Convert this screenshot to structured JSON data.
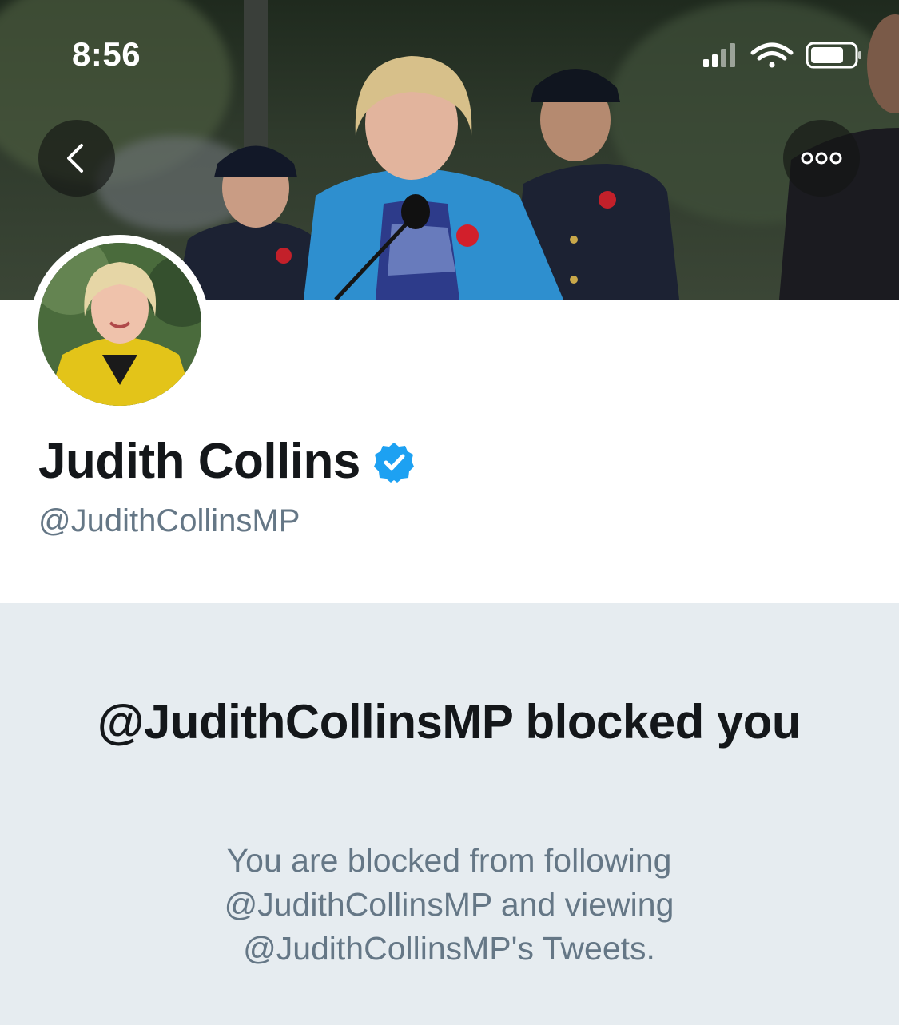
{
  "status_bar": {
    "time": "8:56",
    "icons": [
      "cellular-signal-icon",
      "wifi-icon",
      "battery-icon"
    ]
  },
  "header": {
    "back_icon": "chevron-left-icon",
    "more_icon": "more-horizontal-icon"
  },
  "profile": {
    "name": "Judith Collins",
    "verified": true,
    "handle": "@JudithCollinsMP"
  },
  "blocked": {
    "title": "@JudithCollinsMP blocked you",
    "description": "You are blocked from following @JudithCollinsMP and viewing @JudithCollinsMP's Tweets."
  },
  "colors": {
    "verified_blue": "#1da1f2",
    "name_text": "#14171a",
    "secondary_text": "#657786",
    "panel_background": "#e6ecf0"
  }
}
